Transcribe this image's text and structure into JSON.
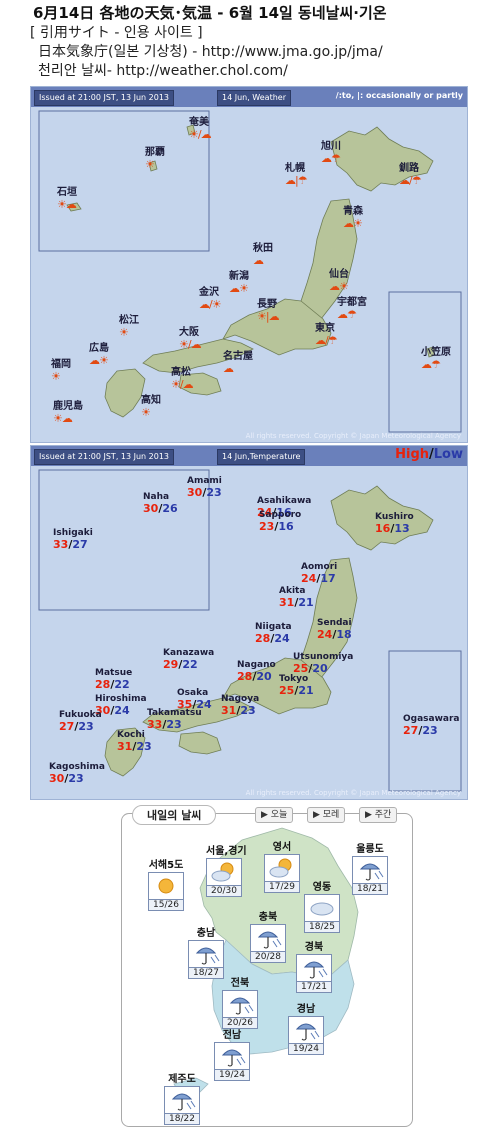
{
  "header": {
    "line1": "6月14日 各地の天気･気温 - 6월 14일 동네날씨·기온",
    "line2": "[ 引用サイト - 인용 사이트 ]",
    "line3": "日本気象庁(일본 기상청) - http://www.jma.go.jp/jma/",
    "line4": "천리안 날씨- http://weather.chol.com/"
  },
  "weather_map": {
    "issued": "Issued at 21:00 JST, 13 Jun 2013",
    "date_tag": "14 Jun, Weather",
    "legend": "/:to, |: occasionally or partly",
    "copyright": "All rights reserved. Copyright © Japan Meteorological Agency",
    "cities": [
      {
        "name": "奄美",
        "symbols": "☀/☁"
      },
      {
        "name": "那覇",
        "symbols": "☀"
      },
      {
        "name": "石垣",
        "symbols": "☀☁"
      },
      {
        "name": "旭川",
        "symbols": "☁☂"
      },
      {
        "name": "札幌",
        "symbols": "☁|☂"
      },
      {
        "name": "釧路",
        "symbols": "☁/☂"
      },
      {
        "name": "青森",
        "symbols": "☁☀"
      },
      {
        "name": "秋田",
        "symbols": "☁"
      },
      {
        "name": "仙台",
        "symbols": "☁☀"
      },
      {
        "name": "新潟",
        "symbols": "☁☀"
      },
      {
        "name": "金沢",
        "symbols": "☁/☀"
      },
      {
        "name": "長野",
        "symbols": "☀|☁"
      },
      {
        "name": "宇都宮",
        "symbols": "☁☂"
      },
      {
        "name": "東京",
        "symbols": "☁/☂"
      },
      {
        "name": "松江",
        "symbols": "☀"
      },
      {
        "name": "大阪",
        "symbols": "☀/☁"
      },
      {
        "name": "広島",
        "symbols": "☁☀"
      },
      {
        "name": "福岡",
        "symbols": "☀"
      },
      {
        "name": "高松",
        "symbols": "☀/☁"
      },
      {
        "name": "名古屋",
        "symbols": "☁"
      },
      {
        "name": "高知",
        "symbols": "☀"
      },
      {
        "name": "鹿児島",
        "symbols": "☀☁"
      },
      {
        "name": "小笠原",
        "symbols": "☁☂"
      }
    ]
  },
  "temperature_map": {
    "issued": "Issued at 21:00 JST, 13 Jun 2013",
    "date_tag": "14 Jun,Temperature",
    "high_label": "High",
    "slash": "/",
    "low_label": "Low",
    "copyright": "All rights reserved. Copyright © Japan Meteorological Agency",
    "cities": [
      {
        "name": "Amami",
        "high": "30",
        "low": "23"
      },
      {
        "name": "Naha",
        "high": "30",
        "low": "26"
      },
      {
        "name": "Ishigaki",
        "high": "33",
        "low": "27"
      },
      {
        "name": "Asahikawa",
        "high": "24",
        "low": "16"
      },
      {
        "name": "Sapporo",
        "high": "23",
        "low": "16"
      },
      {
        "name": "Kushiro",
        "high": "16",
        "low": "13"
      },
      {
        "name": "Aomori",
        "high": "24",
        "low": "17"
      },
      {
        "name": "Akita",
        "high": "31",
        "low": "21"
      },
      {
        "name": "Niigata",
        "high": "28",
        "low": "24"
      },
      {
        "name": "Sendai",
        "high": "24",
        "low": "18"
      },
      {
        "name": "Kanazawa",
        "high": "29",
        "low": "22"
      },
      {
        "name": "Nagano",
        "high": "28",
        "low": "20"
      },
      {
        "name": "Utsunomiya",
        "high": "25",
        "low": "20"
      },
      {
        "name": "Tokyo",
        "high": "25",
        "low": "21"
      },
      {
        "name": "Matsue",
        "high": "28",
        "low": "22"
      },
      {
        "name": "Osaka",
        "high": "35",
        "low": "24"
      },
      {
        "name": "Hiroshima",
        "high": "30",
        "low": "24"
      },
      {
        "name": "Nagoya",
        "high": "31",
        "low": "23"
      },
      {
        "name": "Fukuoka",
        "high": "27",
        "low": "23"
      },
      {
        "name": "Takamatsu",
        "high": "33",
        "low": "23"
      },
      {
        "name": "Kochi",
        "high": "31",
        "low": "23"
      },
      {
        "name": "Kagoshima",
        "high": "30",
        "low": "23"
      },
      {
        "name": "Ogasawara",
        "high": "27",
        "low": "23"
      }
    ]
  },
  "korea_panel": {
    "title": "내일의 날씨",
    "buttons": [
      "▶ 오늘",
      "▶ 모레",
      "▶ 주간"
    ],
    "regions": [
      {
        "name": "서해5도",
        "icon": "sunny-icon",
        "temp": "15/26"
      },
      {
        "name": "서울,경기",
        "icon": "partly-cloudy-icon",
        "temp": "20/30"
      },
      {
        "name": "영서",
        "icon": "partly-cloudy-icon",
        "temp": "17/29"
      },
      {
        "name": "영동",
        "icon": "cloudy-icon",
        "temp": "18/25"
      },
      {
        "name": "울릉도",
        "icon": "umbrella-icon",
        "temp": "18/21"
      },
      {
        "name": "충남",
        "icon": "umbrella-icon",
        "temp": "18/27"
      },
      {
        "name": "충북",
        "icon": "umbrella-icon",
        "temp": "20/28"
      },
      {
        "name": "경북",
        "icon": "umbrella-icon",
        "temp": "17/21"
      },
      {
        "name": "전북",
        "icon": "umbrella-icon",
        "temp": "20/26"
      },
      {
        "name": "경남",
        "icon": "umbrella-icon",
        "temp": "19/24"
      },
      {
        "name": "전남",
        "icon": "umbrella-icon",
        "temp": "19/24"
      },
      {
        "name": "제주도",
        "icon": "umbrella-icon",
        "temp": "18/22"
      }
    ]
  },
  "colors": {
    "sea": "#c5d5ec",
    "land_japan": "#b7c49a",
    "land_korea_north": "#cfe3c6",
    "land_korea_south": "#bfe0ea",
    "high": "#e8220c",
    "low": "#2a3aa8"
  }
}
